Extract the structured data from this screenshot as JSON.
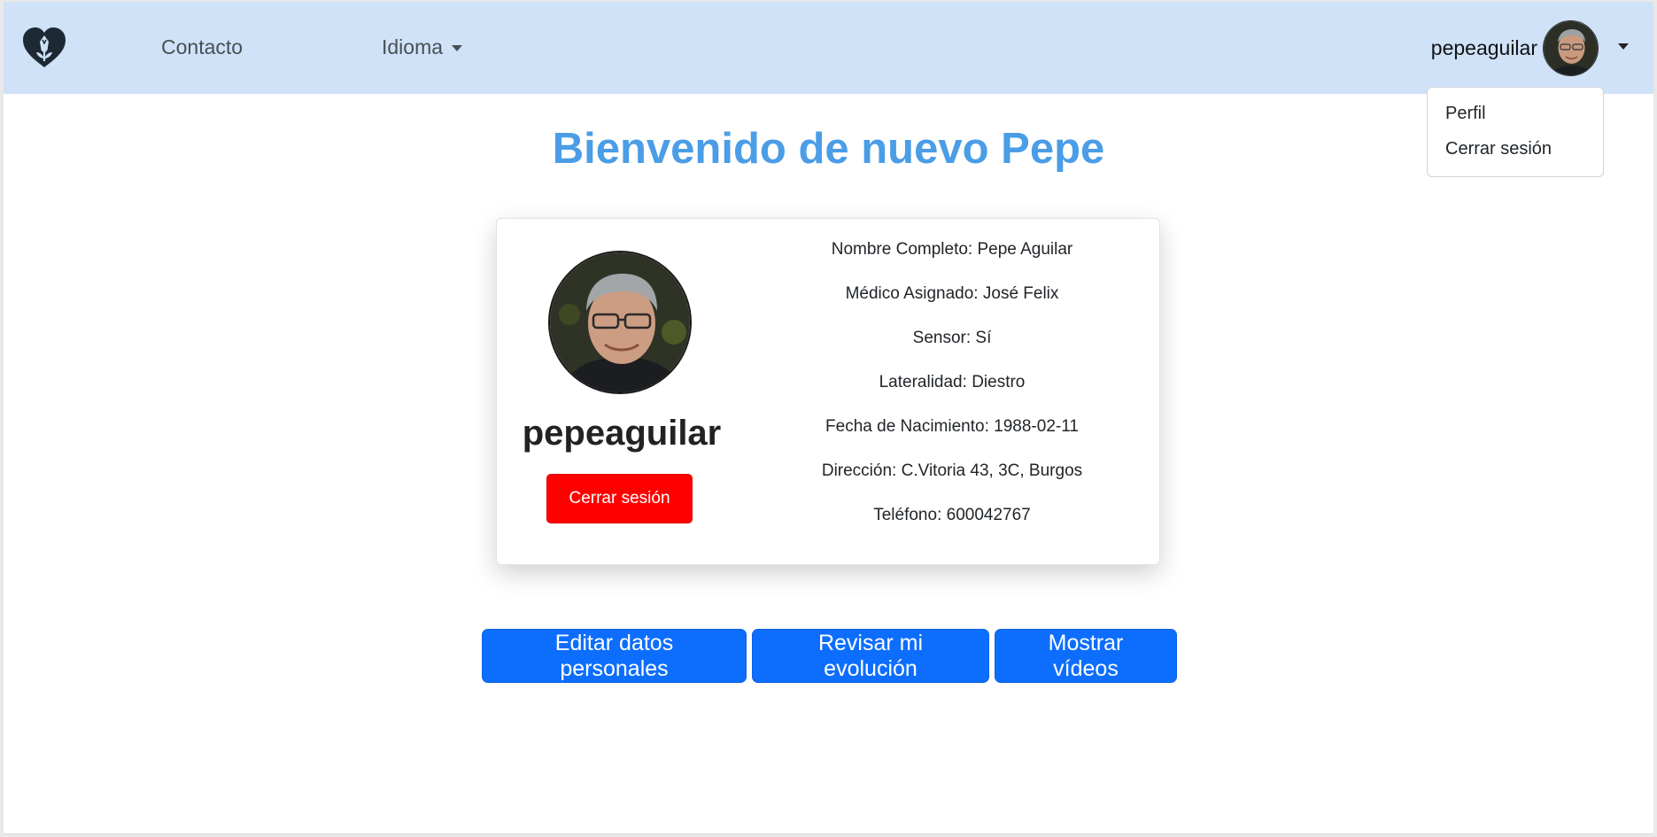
{
  "navbar": {
    "logo_icon": "heart-tulip-logo",
    "links": {
      "contacto": "Contacto",
      "idioma": "Idioma"
    },
    "user": {
      "username": "pepeaguilar",
      "avatar_icon": "user-avatar"
    }
  },
  "dropdown": {
    "items": [
      "Perfil",
      "Cerrar sesión"
    ]
  },
  "main": {
    "welcome_title": "Bienvenido de nuevo Pepe",
    "profile_card": {
      "username": "pepeaguilar",
      "logout_label": "Cerrar sesión",
      "fields": [
        {
          "label": "Nombre Completo:",
          "value": "Pepe Aguilar"
        },
        {
          "label": "Médico Asignado:",
          "value": "José Felix"
        },
        {
          "label": "Sensor:",
          "value": "Sí"
        },
        {
          "label": "Lateralidad:",
          "value": "Diestro"
        },
        {
          "label": "Fecha de Nacimiento:",
          "value": "1988-02-11"
        },
        {
          "label": "Dirección:",
          "value": "C.Vitoria 43, 3C, Burgos"
        },
        {
          "label": "Teléfono:",
          "value": "600042767"
        }
      ]
    },
    "actions": {
      "edit": "Editar datos personales",
      "evolution": "Revisar mi evolución",
      "videos": "Mostrar vídeos"
    }
  },
  "colors": {
    "navbar_bg": "#cfe2f8",
    "title": "#4a9de6",
    "primary": "#0d6efd",
    "danger": "#ff0000"
  }
}
